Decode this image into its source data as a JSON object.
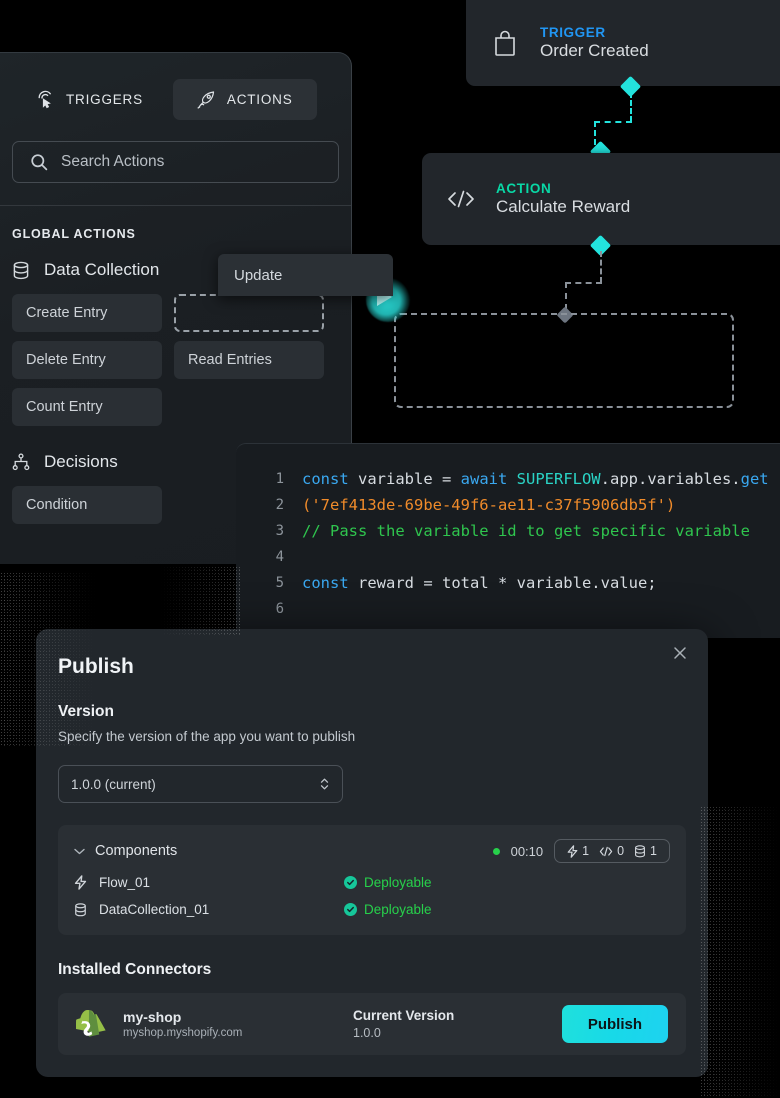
{
  "canvas": {
    "nodes": [
      {
        "id": "trigger",
        "kind_label": "TRIGGER",
        "title": "Order Created",
        "icon": "shopping-bag-icon",
        "kind_color": "#2196f3"
      },
      {
        "id": "action",
        "kind_label": "ACTION",
        "title": "Calculate Reward",
        "icon": "code-brackets-icon",
        "kind_color": "#09d8a6"
      }
    ],
    "connector_color": "#23e3dd",
    "placeholder_color": "#8a9199",
    "cursor_color": "#2df0ec"
  },
  "drag_item": {
    "label": "Update"
  },
  "sidebar": {
    "tabs": [
      {
        "label": "TRIGGERS",
        "icon": "cursor-click-icon",
        "active": false
      },
      {
        "label": "ACTIONS",
        "icon": "rocket-icon",
        "active": true
      }
    ],
    "search": {
      "placeholder": "Search Actions",
      "value": "",
      "icon": "search-icon"
    },
    "section_label": "GLOBAL ACTIONS",
    "groups": [
      {
        "name": "Data Collection",
        "icon": "database-icon",
        "chips": [
          {
            "label": "Create Entry",
            "ghost": false
          },
          {
            "label": "",
            "ghost": true
          },
          {
            "label": "Delete Entry",
            "ghost": false
          },
          {
            "label": "Read Entries",
            "ghost": false
          },
          {
            "label": "Count Entry",
            "ghost": false
          }
        ]
      },
      {
        "name": "Decisions",
        "icon": "branch-icon",
        "chips": [
          {
            "label": "Condition",
            "ghost": false
          }
        ]
      }
    ]
  },
  "code_editor": {
    "lines": [
      {
        "num": "1",
        "tokens": [
          {
            "t": "const ",
            "c": "kw"
          },
          {
            "t": "variable = ",
            "c": "plain"
          },
          {
            "t": "await ",
            "c": "kw"
          },
          {
            "t": "SUPERFLOW",
            "c": "cy"
          },
          {
            "t": ".app.variables.",
            "c": "plain"
          },
          {
            "t": "get",
            "c": "kw"
          }
        ]
      },
      {
        "num": "2",
        "tokens": [
          {
            "t": "('7ef413de-69be-49f6-ae11-c37f5906db5f')",
            "c": "str"
          }
        ]
      },
      {
        "num": "3",
        "tokens": [
          {
            "t": "// Pass the variable id to get specific variable",
            "c": "com"
          }
        ]
      },
      {
        "num": "4",
        "tokens": []
      },
      {
        "num": "5",
        "tokens": [
          {
            "t": "const ",
            "c": "kw"
          },
          {
            "t": "reward = total * variable.value;",
            "c": "plain"
          }
        ]
      },
      {
        "num": "6",
        "tokens": []
      }
    ]
  },
  "publish_dialog": {
    "title": "Publish",
    "close_label": "×",
    "version_heading": "Version",
    "version_description": "Specify the version of the app you want to publish",
    "version_select": {
      "value": "1.0.0 (current)"
    },
    "components": {
      "heading": "Components",
      "timer": "00:10",
      "status_dot_color": "#27d14b",
      "badges": [
        {
          "icon": "lightning-icon",
          "count": "1"
        },
        {
          "icon": "code-icon",
          "count": "0"
        },
        {
          "icon": "database-icon",
          "count": "1"
        }
      ],
      "rows": [
        {
          "icon": "lightning-icon",
          "name": "Flow_01",
          "status": "Deployable"
        },
        {
          "icon": "database-icon",
          "name": "DataCollection_01",
          "status": "Deployable"
        }
      ]
    },
    "connectors": {
      "heading": "Installed Connectors",
      "items": [
        {
          "icon": "shopify-icon",
          "name": "my-shop",
          "domain": "myshop.myshopify.com",
          "version_label": "Current Version",
          "version_value": "1.0.0",
          "action_label": "Publish"
        }
      ]
    }
  }
}
